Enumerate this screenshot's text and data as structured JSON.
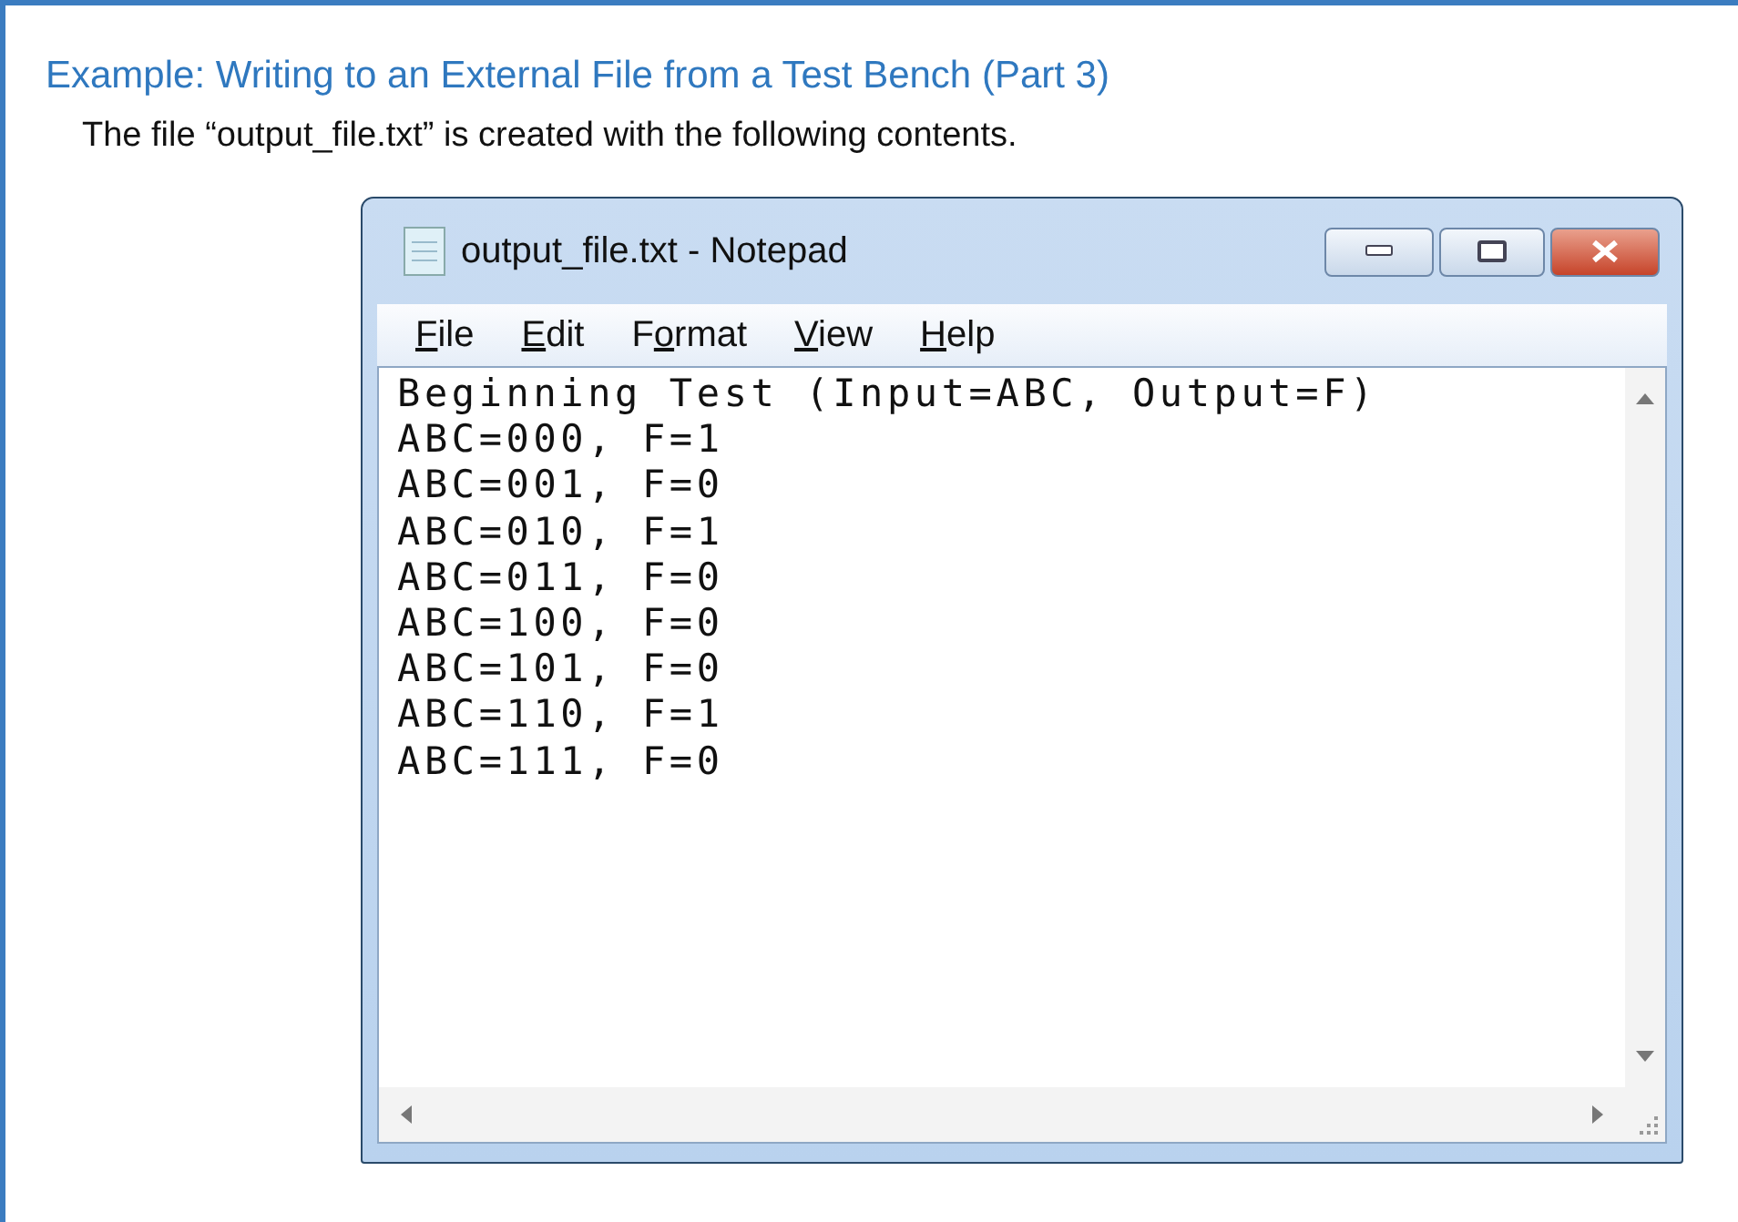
{
  "slide": {
    "title": "Example: Writing to an External File from a Test Bench (Part 3)",
    "caption": "The file “output_file.txt” is created with the following contents."
  },
  "window": {
    "title": "output_file.txt - Notepad",
    "menu": [
      {
        "key": "F",
        "rest": "ile"
      },
      {
        "key": "E",
        "rest": "dit"
      },
      {
        "key": "o",
        "rest": "rmat",
        "prefix": "F"
      },
      {
        "key": "V",
        "rest": "iew"
      },
      {
        "key": "H",
        "rest": "elp"
      }
    ],
    "lines": [
      "Beginning Test (Input=ABC, Output=F)",
      "ABC=000, F=1",
      "ABC=001, F=0",
      "ABC=010, F=1",
      "ABC=011, F=0",
      "ABC=100, F=0",
      "ABC=101, F=0",
      "ABC=110, F=1",
      "ABC=111, F=0"
    ]
  }
}
